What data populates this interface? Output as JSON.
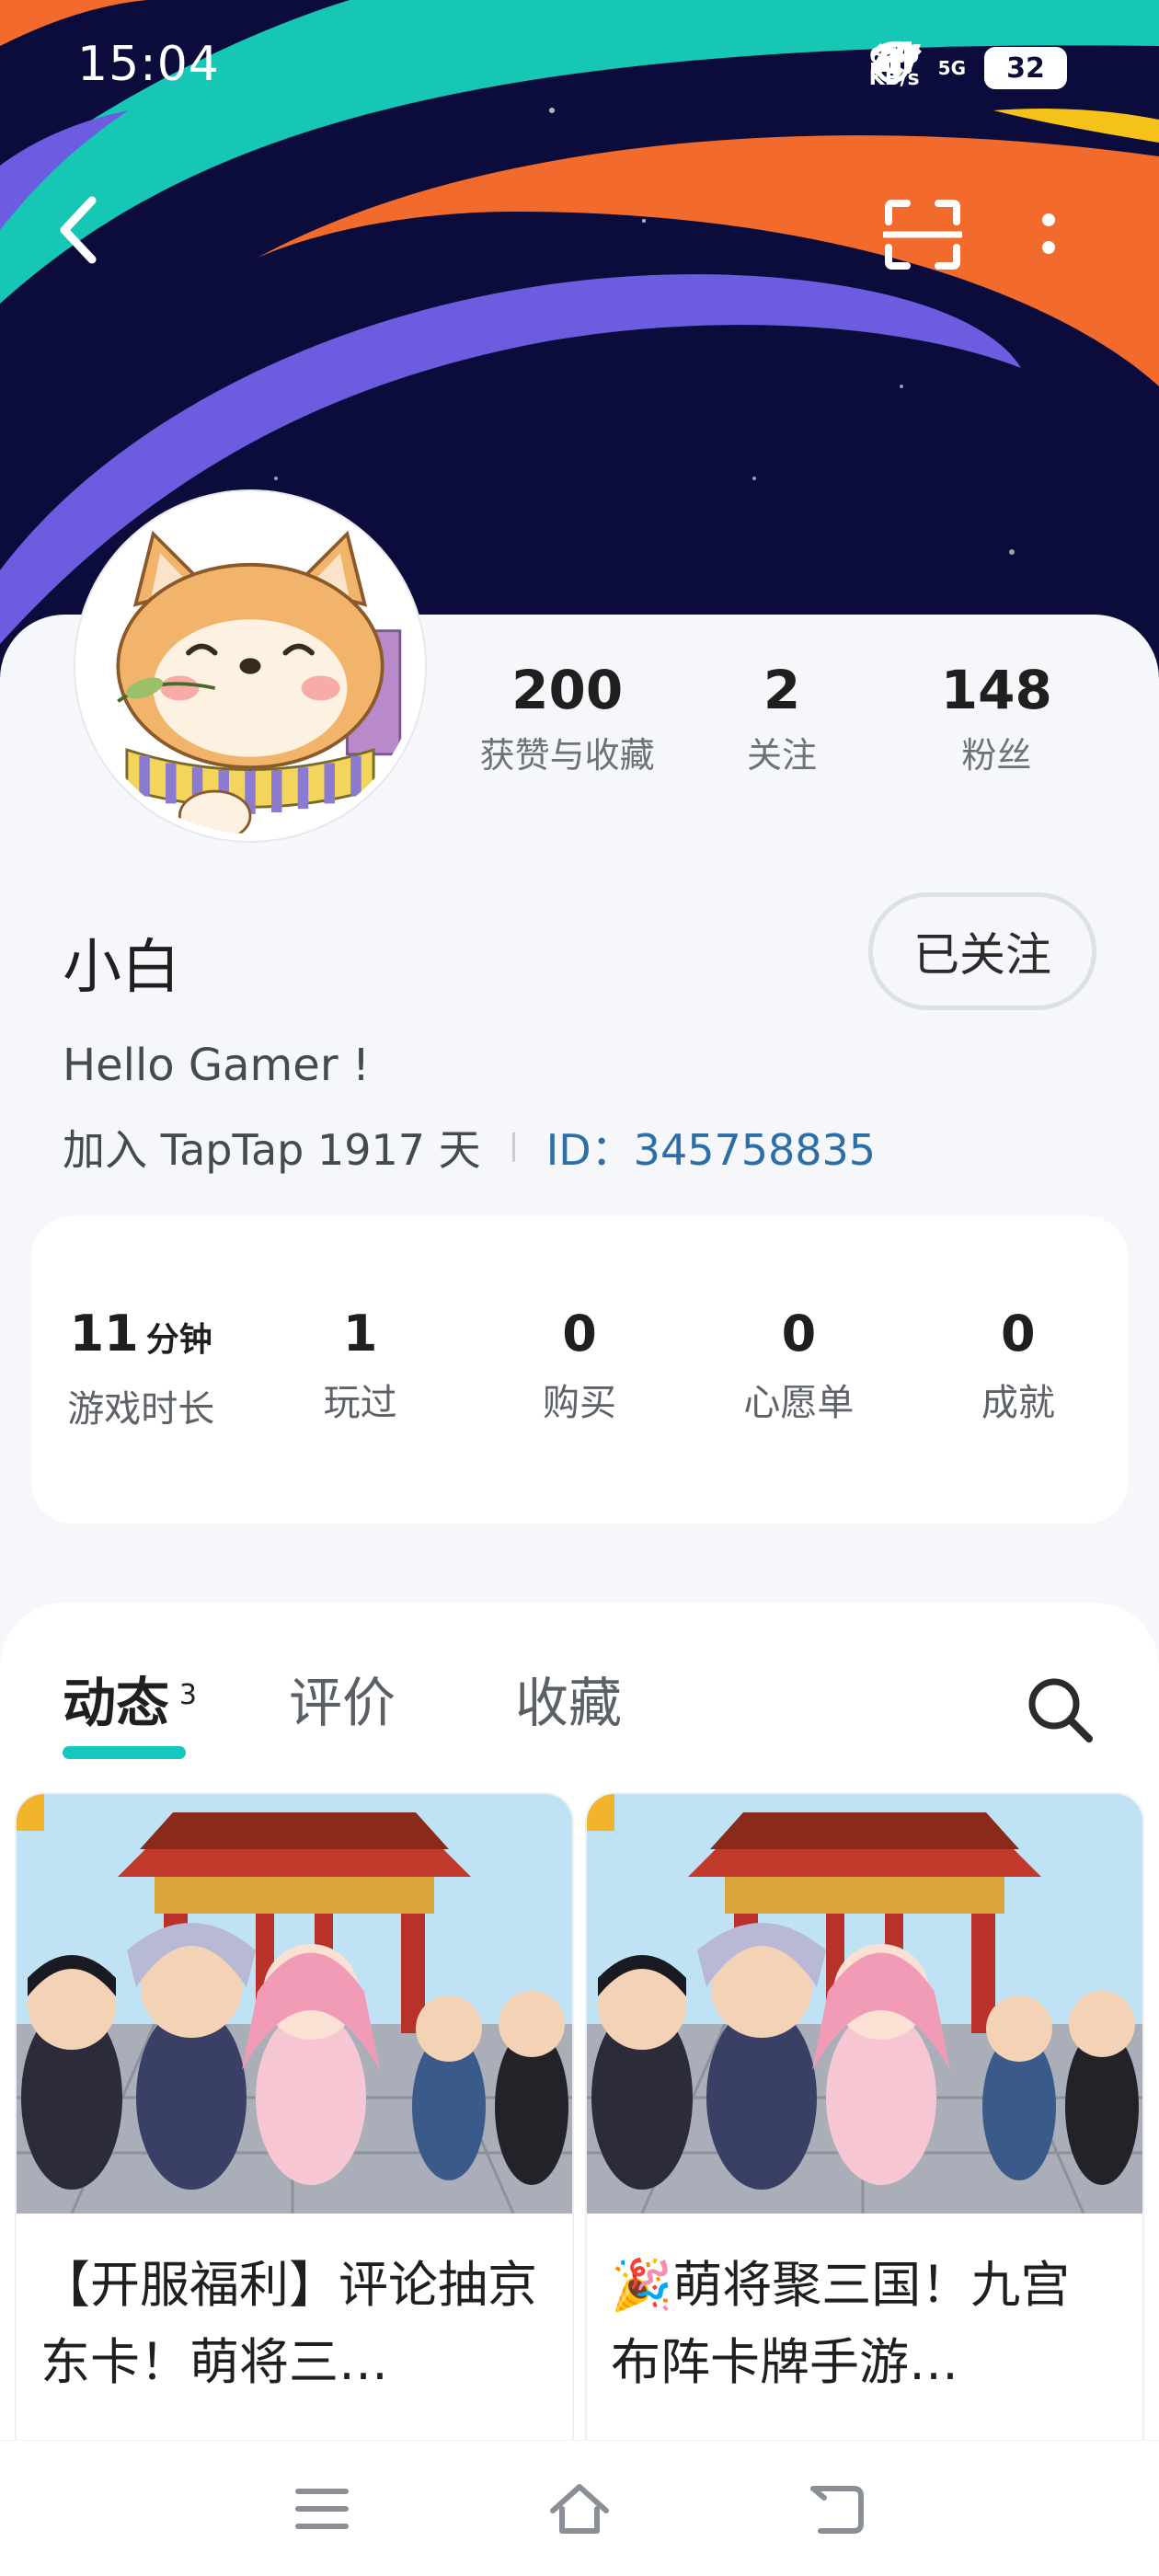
{
  "status_bar": {
    "time": "15:04",
    "net_speed_value": "67.0",
    "net_speed_unit": "KB/s",
    "network": "5G",
    "battery": "32"
  },
  "icons": {
    "back": "chevron-left-icon",
    "scan": "scan-icon",
    "more": "more-vertical-icon",
    "search": "search-icon",
    "alarm": "alarm-icon",
    "signal": "signal-icon",
    "wifi": "wifi-icon"
  },
  "profile": {
    "name": "小白",
    "bio": "Hello Gamer !",
    "joined": "加入 TapTap 1917 天",
    "id": "ID：345758835",
    "follow_label": "已关注",
    "stats": [
      {
        "value": "200",
        "label": "获赞与收藏"
      },
      {
        "value": "2",
        "label": "关注"
      },
      {
        "value": "148",
        "label": "粉丝"
      }
    ]
  },
  "game_stats": [
    {
      "value": "11",
      "unit": "分钟",
      "label": "游戏时长"
    },
    {
      "value": "1",
      "unit": "",
      "label": "玩过"
    },
    {
      "value": "0",
      "unit": "",
      "label": "购买"
    },
    {
      "value": "0",
      "unit": "",
      "label": "心愿单"
    },
    {
      "value": "0",
      "unit": "",
      "label": "成就"
    }
  ],
  "tabs": [
    {
      "label": "动态",
      "count": "3"
    },
    {
      "label": "评价",
      "count": ""
    },
    {
      "label": "收藏",
      "count": ""
    }
  ],
  "feed": [
    {
      "title": "【开服福利】评论抽京东卡！萌将三…"
    },
    {
      "title": "🎉萌将聚三国！九宫布阵卡牌手游…"
    }
  ],
  "colors": {
    "accent": "#14c8c0",
    "id_link": "#2d6ea6",
    "banner_bg": "#0c0c3c"
  }
}
